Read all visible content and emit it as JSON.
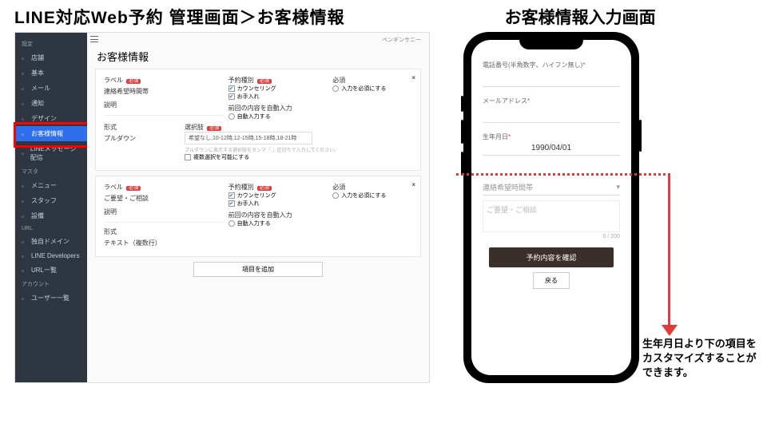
{
  "titles": {
    "left": "LINE対応Web予約 管理画面＞お客様情報",
    "right": "お客様情報入力画面"
  },
  "admin": {
    "topRight": "ペンギンサニー",
    "heading": "お客様情報",
    "sidebar": {
      "sections": [
        {
          "label": "設定",
          "items": [
            {
              "icon": "shop-icon",
              "text": "店舗"
            },
            {
              "icon": "cog-icon",
              "text": "基本"
            },
            {
              "icon": "mail-icon",
              "text": "メール"
            },
            {
              "icon": "bell-icon",
              "text": "通知"
            },
            {
              "icon": "palette-icon",
              "text": "デザイン"
            },
            {
              "icon": "list-icon",
              "text": "お客様情報",
              "active": true
            },
            {
              "icon": "line-icon",
              "text": "LINEメッセージ配信"
            }
          ]
        },
        {
          "label": "マスタ",
          "items": [
            {
              "icon": "menu-icon",
              "text": "メニュー"
            },
            {
              "icon": "user-icon",
              "text": "スタッフ"
            },
            {
              "icon": "gear-icon",
              "text": "設備"
            }
          ]
        },
        {
          "label": "URL",
          "items": [
            {
              "icon": "globe-icon",
              "text": "独自ドメイン"
            },
            {
              "icon": "line-dev-icon",
              "text": "LINE Developers"
            },
            {
              "icon": "link-icon",
              "text": "URL一覧"
            }
          ]
        },
        {
          "label": "アカウント",
          "items": [
            {
              "icon": "users-icon",
              "text": "ユーザー一覧"
            }
          ]
        }
      ]
    },
    "card1": {
      "labelTitle": "ラベル",
      "labelVal": "連絡希望時間帯",
      "descTitle": "説明",
      "formTitle": "形式",
      "formVal": "プルダウン",
      "optTitle": "選択肢",
      "optVal": "希望なし,10-12時,12-15時,15-18時,18-21時",
      "optHint": "プルダウンに表示する選択肢をカンマ「,」区切りで入力してください。",
      "optMulti": "複数選択を可能にする",
      "yoyakuTitle": "予約種別",
      "yoyaku1": "カウンセリング",
      "yoyaku2": "お手入れ",
      "reqTitle": "必須",
      "reqOpt": "入力を必須にする",
      "autoTitle": "前回の内容を自動入力",
      "autoOpt": "自動入力する"
    },
    "card2": {
      "labelTitle": "ラベル",
      "labelVal": "ご要望・ご相談",
      "descTitle": "説明",
      "formTitle": "形式",
      "formVal": "テキスト（複数行）",
      "yoyakuTitle": "予約種別",
      "yoyaku1": "カウンセリング",
      "yoyaku2": "お手入れ",
      "reqTitle": "必須",
      "reqOpt": "入力を必須にする",
      "autoTitle": "前回の内容を自動入力",
      "autoOpt": "自動入力する"
    },
    "addBtn": "項目を追加",
    "badge": "必須"
  },
  "phone": {
    "telLabel": "電話番号(半角数字、ハイフン無し)",
    "telVal": "　",
    "emailLabel": "メールアドレス",
    "emailVal": "　",
    "birthLabel": "生年月日",
    "birthVal": "1990/04/01",
    "contactLabel": "連絡希望時間帯",
    "consultLabel": "ご要望・ご相談",
    "count": "0 / 200",
    "submit": "予約内容を確認",
    "back": "戻る"
  },
  "caption": "生年月日より下の項目をカスタマイズすることができます。"
}
